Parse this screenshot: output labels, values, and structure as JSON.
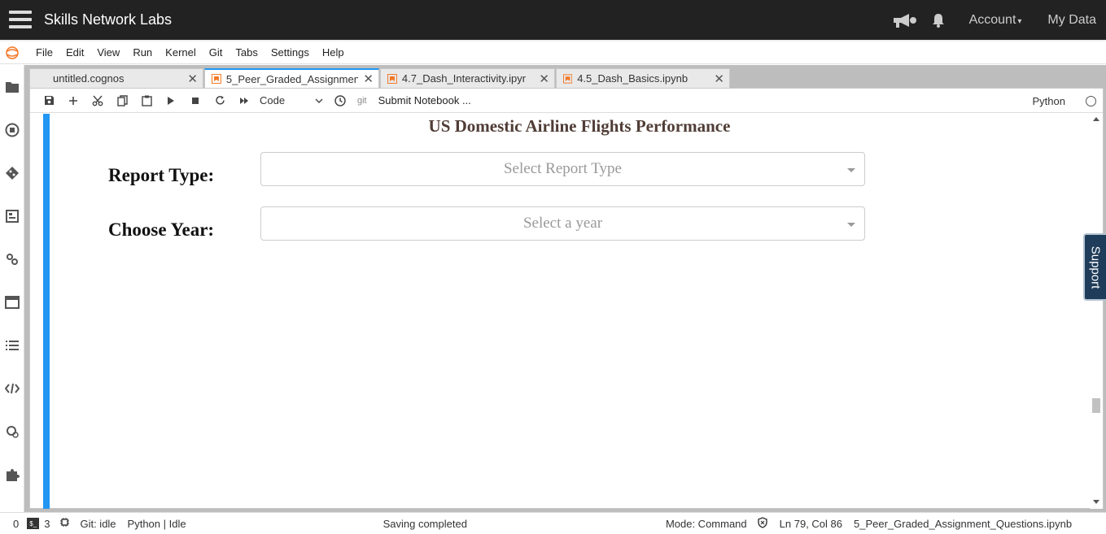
{
  "header": {
    "brand": "Skills Network Labs",
    "account_label": "Account",
    "mydata_label": "My Data"
  },
  "menubar": {
    "items": [
      "File",
      "Edit",
      "View",
      "Run",
      "Kernel",
      "Git",
      "Tabs",
      "Settings",
      "Help"
    ]
  },
  "tabs": [
    {
      "label": "untitled.cognos",
      "active": false
    },
    {
      "label": "5_Peer_Graded_Assignmen",
      "active": true
    },
    {
      "label": "4.7_Dash_Interactivity.ipyr",
      "active": false
    },
    {
      "label": "4.5_Dash_Basics.ipynb",
      "active": false
    }
  ],
  "toolbar": {
    "cell_type": "Code",
    "git_label": "git",
    "submit_label": "Submit Notebook ...",
    "kernel_name": "Python"
  },
  "dashboard": {
    "title": "US Domestic Airline Flights Performance",
    "report_type_label": "Report Type:",
    "report_type_placeholder": "Select Report Type",
    "year_label": "Choose Year:",
    "year_placeholder": "Select a year"
  },
  "support_label": "Support",
  "statusbar": {
    "count_left": "0",
    "terminal_count": "3",
    "git_status": "Git: idle",
    "kernel_status": "Python | Idle",
    "saving": "Saving completed",
    "mode": "Mode: Command",
    "position": "Ln 79, Col 86",
    "filename": "5_Peer_Graded_Assignment_Questions.ipynb"
  },
  "colors": {
    "header_bg": "#222222",
    "accent_blue": "#2196f3",
    "title_color": "#503D36",
    "support_bg": "#1f3c5a"
  }
}
